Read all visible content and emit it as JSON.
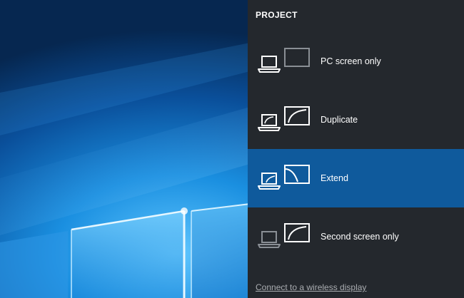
{
  "panel": {
    "title": "PROJECT",
    "background": "#24282d",
    "selected_color": "#0f5a9c",
    "options": [
      {
        "label": "PC screen only",
        "icon": "pc-screen-only-icon",
        "selected": false
      },
      {
        "label": "Duplicate",
        "icon": "duplicate-icon",
        "selected": false
      },
      {
        "label": "Extend",
        "icon": "extend-icon",
        "selected": true
      },
      {
        "label": "Second screen only",
        "icon": "second-screen-only-icon",
        "selected": false
      }
    ],
    "wireless_link": "Connect to a wireless display"
  },
  "desktop": {
    "wallpaper": "windows-10-hero-wallpaper",
    "accent": "#1a8fe0"
  }
}
